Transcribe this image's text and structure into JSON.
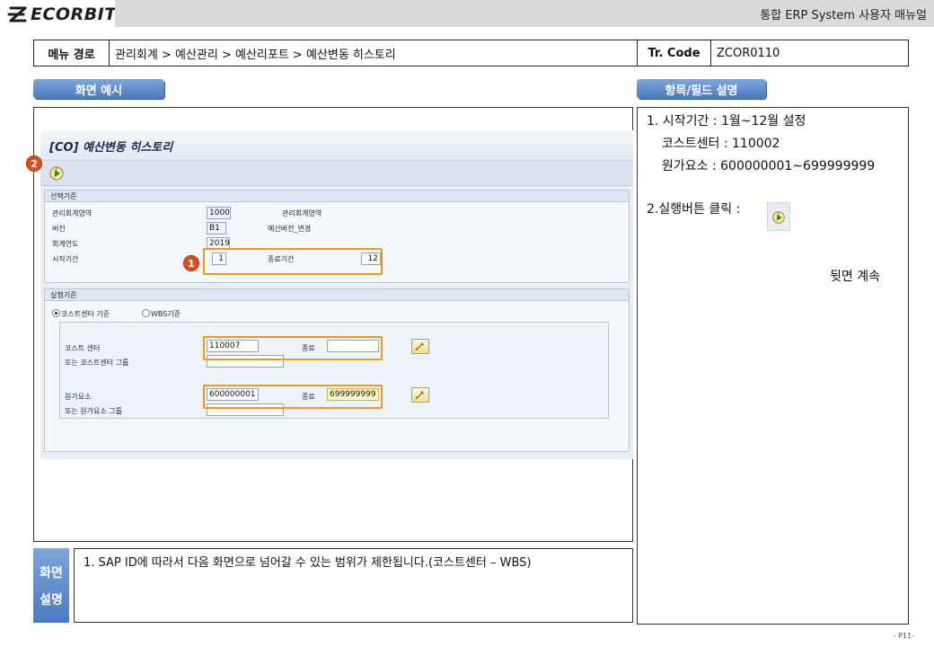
{
  "header": {
    "logo_text": "ECORBIT",
    "manual_title": "통합 ERP System 사용자 매뉴얼"
  },
  "menu_path": {
    "label": "메뉴 경로",
    "path": "관리회계 > 예산관리 > 예산리포트 > 예산변동 히스토리",
    "tr_label": "Tr. Code",
    "tr_code": "ZCOR0110"
  },
  "sections": {
    "screen_example": "화면 예시",
    "field_desc": "항목/필드 설명",
    "screen_desc_line1": "화면",
    "screen_desc_line2": "설명"
  },
  "sap": {
    "title": "[CO] 예산변동 히스토리",
    "badge_exec": "2",
    "badge_period": "1",
    "selection_group": {
      "title": "선택기준",
      "controlling_area_label": "관리회계영역",
      "controlling_area_value": "1000",
      "controlling_area_desc": "관리회계영역",
      "version_label": "버전",
      "version_value": "B1",
      "version_desc": "예산버전_변경",
      "fiscal_year_label": "회계연도",
      "fiscal_year_value": "2019",
      "start_period_label": "시작기간",
      "start_period_value": "1",
      "end_period_label": "종료기간",
      "end_period_value": "12"
    },
    "execution_group": {
      "title": "실행기준",
      "radio_cost_center": "코스트센터 기준",
      "radio_wbs": "WBS기준",
      "cost_center_label": "코스트 센터",
      "cost_center_value": "110007",
      "cost_center_to_label": "종료",
      "cost_center_to_value": "",
      "cost_center_group_label": "또는 코스트센터 그룹",
      "cost_element_label": "원가요소",
      "cost_element_value": "600000001",
      "cost_element_to_label": "종료",
      "cost_element_to_value": "699999999",
      "cost_element_group_label": "또는 원가요소 그룹"
    }
  },
  "field_desc": {
    "line1": "1. 시작기간 : 1월~12월 설정",
    "line2": "코스트센터 : 110002",
    "line3": "원가요소 : 600000001~699999999",
    "line4": "2.실행버튼 클릭 :",
    "continue": "뒷면 계속"
  },
  "screen_desc": {
    "text": "1.   SAP ID에 따라서 다음 화면으로 넘어갈 수 있는 범위가 제한됩니다.(코스트센터 – WBS)"
  },
  "page_number": "- P11-",
  "colors": {
    "accent_blue": "#4a79bf",
    "highlight_orange": "#f0961c",
    "badge_red": "#d9501e"
  }
}
